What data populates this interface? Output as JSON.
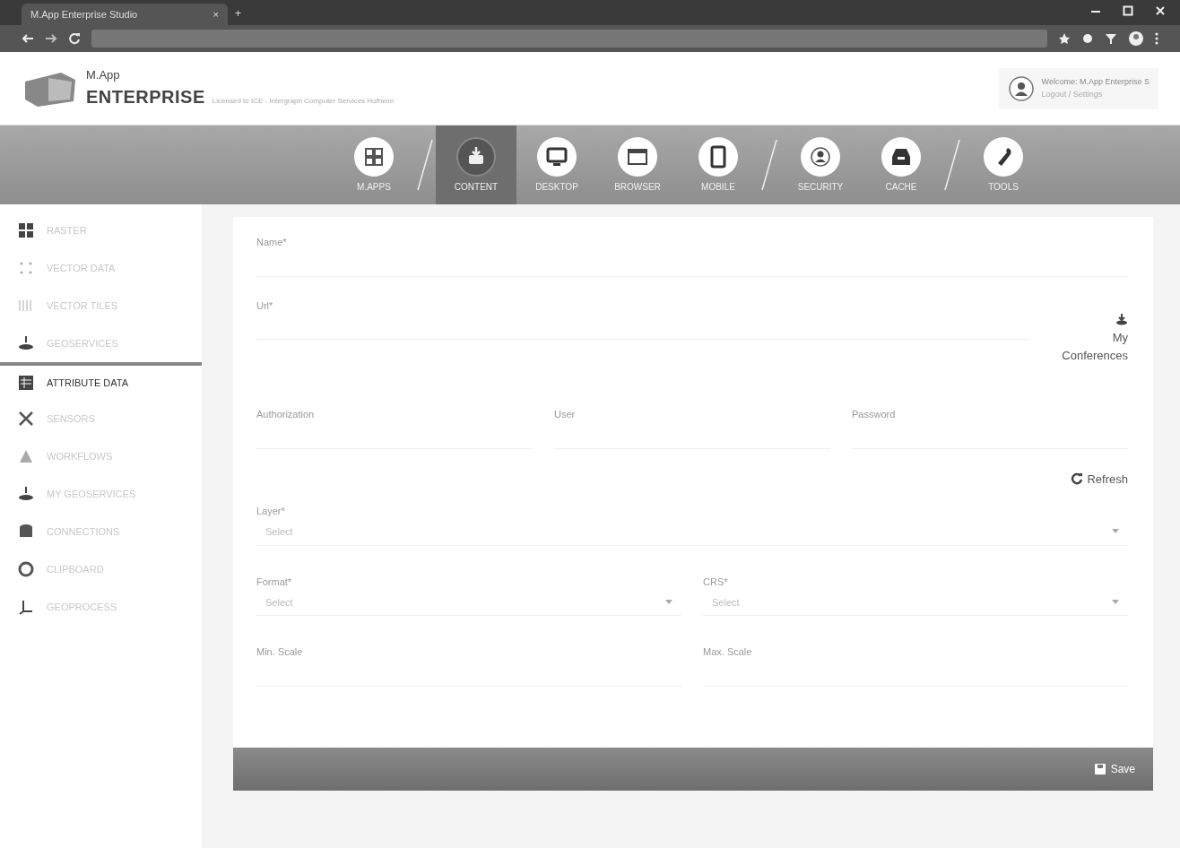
{
  "browser": {
    "tab_title": "M.App Enterprise Studio",
    "tab_close": "×",
    "new_tab": "+"
  },
  "header": {
    "logo_small": "M.App",
    "logo_big": "ENTERPRISE",
    "license": "Licensed to ICE - Intergraph Computer Services Hofheim",
    "user_line": "Welcome: M.App Enterprise S",
    "user_sub": "Logout / Settings"
  },
  "nav": [
    {
      "label": "M.APPS",
      "selected": false,
      "sep_after": true
    },
    {
      "label": "CONTENT",
      "selected": true,
      "sep_after": false
    },
    {
      "label": "DESKTOP",
      "selected": false,
      "sep_after": false
    },
    {
      "label": "BROWSER",
      "selected": false,
      "sep_after": false
    },
    {
      "label": "MOBILE",
      "selected": false,
      "sep_after": true
    },
    {
      "label": "SECURITY",
      "selected": false,
      "sep_after": false
    },
    {
      "label": "CACHE",
      "selected": false,
      "sep_after": true
    },
    {
      "label": "TOOLS",
      "selected": false,
      "sep_after": false
    }
  ],
  "sidebar": [
    {
      "label": "RASTER",
      "selected": false
    },
    {
      "label": "VECTOR DATA",
      "selected": false
    },
    {
      "label": "VECTOR TILES",
      "selected": false
    },
    {
      "label": "GEOSERVICES",
      "selected": false
    },
    {
      "label": "ATTRIBUTE DATA",
      "selected": true
    },
    {
      "label": "SENSORS",
      "selected": false
    },
    {
      "label": "WORKFLOWS",
      "selected": false
    },
    {
      "label": "MY GEOSERVICES",
      "selected": false
    },
    {
      "label": "CONNECTIONS",
      "selected": false
    },
    {
      "label": "CLIPBOARD",
      "selected": false
    },
    {
      "label": "GEOPROCESS",
      "selected": false
    }
  ],
  "form": {
    "name_label": "Name*",
    "url_label": "Url*",
    "my_button": "My Conferences",
    "auth_label": "Authorization",
    "user_label": "User",
    "password_label": "Password",
    "refresh_button": "Refresh",
    "layer_label": "Layer*",
    "layer_value": "Select",
    "format_label": "Format*",
    "format_value": "Select",
    "crs_label": "CRS*",
    "crs_value": "Select",
    "min_label": "Min. Scale",
    "max_label": "Max. Scale",
    "save_button": "Save"
  }
}
